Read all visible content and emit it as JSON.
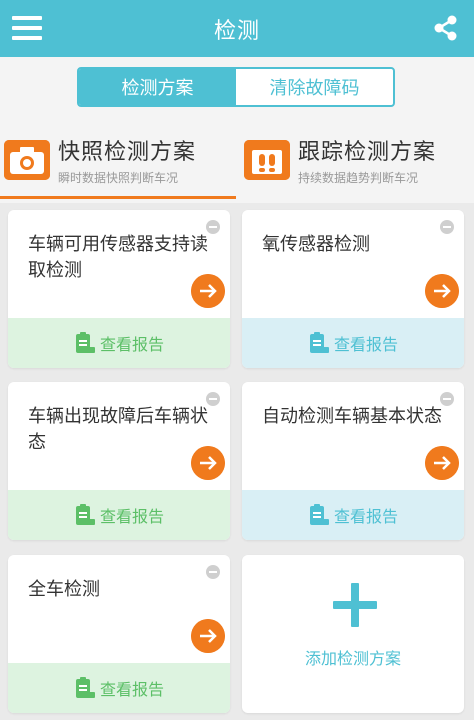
{
  "topbar": {
    "title": "检测",
    "menu_icon": "menu-icon",
    "share_icon": "share-icon",
    "color": "#4ec0d3"
  },
  "segmented": {
    "items": [
      {
        "label": "检测方案",
        "active": true
      },
      {
        "label": "清除故障码",
        "active": false
      }
    ]
  },
  "scheme_tabs": [
    {
      "title": "快照检测方案",
      "subtitle": "瞬时数据快照判断车况",
      "icon": "camera-icon",
      "active": true
    },
    {
      "title": "跟踪检测方案",
      "subtitle": "持续数据趋势判断车况",
      "icon": "footprints-icon",
      "active": false
    }
  ],
  "cards": [
    {
      "title": "车辆可用传感器支持读取检测",
      "report_label": "查看报告",
      "report_style": "green"
    },
    {
      "title": "氧传感器检测",
      "report_label": "查看报告",
      "report_style": "blue"
    },
    {
      "title": "车辆出现故障后车辆状态",
      "report_label": "查看报告",
      "report_style": "green"
    },
    {
      "title": "自动检测车辆基本状态",
      "report_label": "查看报告",
      "report_style": "blue"
    },
    {
      "title": "全车检测",
      "report_label": "查看报告",
      "report_style": "green"
    }
  ],
  "add_card": {
    "label": "添加检测方案",
    "icon": "plus-icon"
  },
  "colors": {
    "accent": "#4ec0d3",
    "orange": "#f07a1d",
    "green_report_bg": "#ddf3e0",
    "green_report_text": "#5cbf67",
    "blue_report_bg": "#d9eff5"
  }
}
